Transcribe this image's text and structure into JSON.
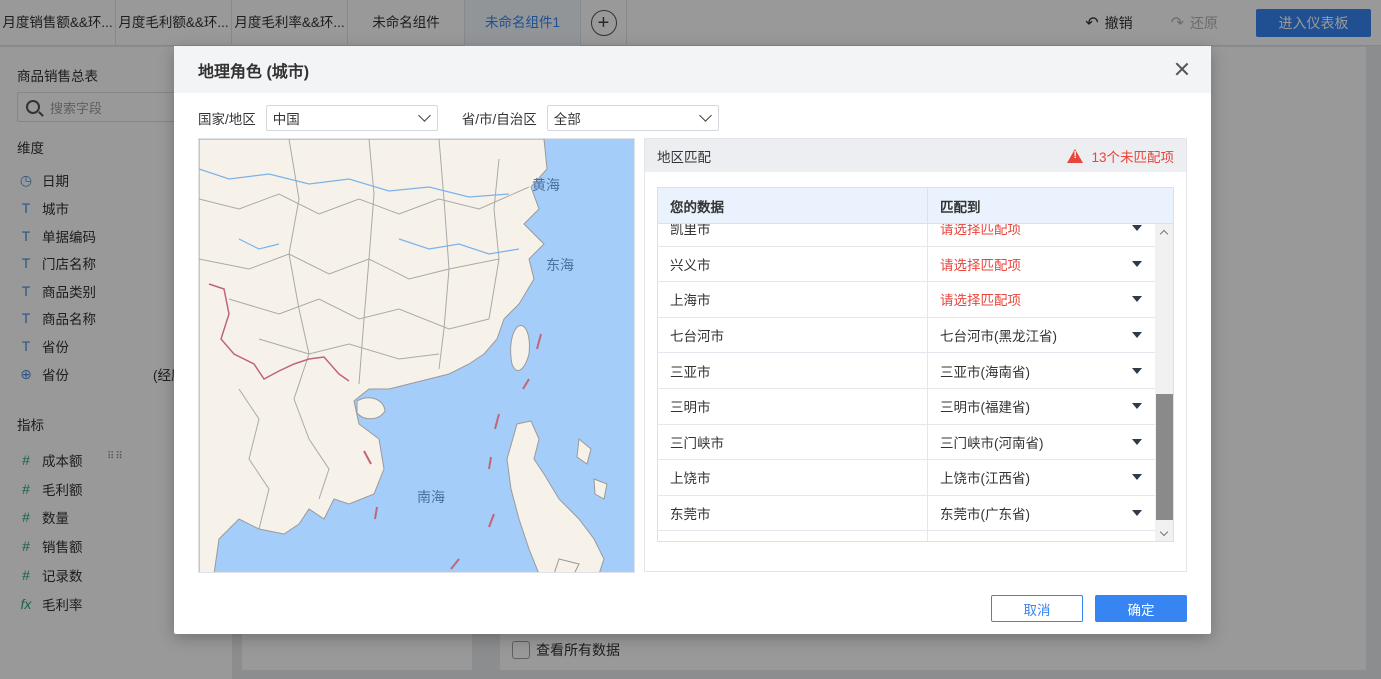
{
  "app": {
    "tabs": [
      {
        "label": "月度销售额&&环..."
      },
      {
        "label": "月度毛利额&&环..."
      },
      {
        "label": "月度毛利率&&环..."
      },
      {
        "label": "未命名组件"
      },
      {
        "label": "未命名组件1"
      }
    ],
    "undo_label": "撤销",
    "redo_label": "还原",
    "enter_dashboard_label": "进入仪表板",
    "accent_color": "#3685f2"
  },
  "sidebar": {
    "title": "商品销售总表",
    "search_placeholder": "搜索字段",
    "dimensions_header": "维度",
    "dimensions": [
      {
        "icon": "clock-icon",
        "label": "日期"
      },
      {
        "icon": "text-type-icon",
        "label": "城市"
      },
      {
        "icon": "text-type-icon",
        "label": "单据编码"
      },
      {
        "icon": "text-type-icon",
        "label": "门店名称"
      },
      {
        "icon": "text-type-icon",
        "label": "商品类别"
      },
      {
        "icon": "text-type-icon",
        "label": "商品名称"
      },
      {
        "icon": "text-type-icon",
        "label": "省份"
      },
      {
        "icon": "globe-icon",
        "label": "省份",
        "extra": "(经度)"
      }
    ],
    "measures_header": "指标",
    "measures": [
      {
        "icon": "hash-icon",
        "label": "成本额"
      },
      {
        "icon": "hash-icon",
        "label": "毛利额"
      },
      {
        "icon": "hash-icon",
        "label": "数量"
      },
      {
        "icon": "hash-icon",
        "label": "销售额"
      },
      {
        "icon": "hash-count-icon",
        "label": "记录数"
      },
      {
        "icon": "formula-icon",
        "label": "毛利率"
      }
    ]
  },
  "main": {
    "view_all_label": "查看所有数据"
  },
  "dialog": {
    "title": "地理角色 (城市)",
    "country_label": "国家/地区",
    "country_value": "中国",
    "province_label": "省/市/自治区",
    "province_value": "全部",
    "map_labels": {
      "yellow_sea": "黄海",
      "east_sea": "东海",
      "south_sea": "南海"
    },
    "match_panel": {
      "title": "地区匹配",
      "warning": "13个未匹配项",
      "col_data": "您的数据",
      "col_match": "匹配到",
      "rows": [
        {
          "data": "凯里市",
          "match": "请选择匹配项",
          "unmatched": true
        },
        {
          "data": "兴义市",
          "match": "请选择匹配项",
          "unmatched": true
        },
        {
          "data": "上海市",
          "match": "请选择匹配项",
          "unmatched": true
        },
        {
          "data": "七台河市",
          "match": "七台河市(黑龙江省)",
          "unmatched": false
        },
        {
          "data": "三亚市",
          "match": "三亚市(海南省)",
          "unmatched": false
        },
        {
          "data": "三明市",
          "match": "三明市(福建省)",
          "unmatched": false
        },
        {
          "data": "三门峡市",
          "match": "三门峡市(河南省)",
          "unmatched": false
        },
        {
          "data": "上饶市",
          "match": "上饶市(江西省)",
          "unmatched": false
        },
        {
          "data": "东莞市",
          "match": "东莞市(广东省)",
          "unmatched": false
        },
        {
          "data": "",
          "match": "",
          "unmatched": false
        }
      ]
    },
    "cancel_label": "取消",
    "ok_label": "确定"
  }
}
